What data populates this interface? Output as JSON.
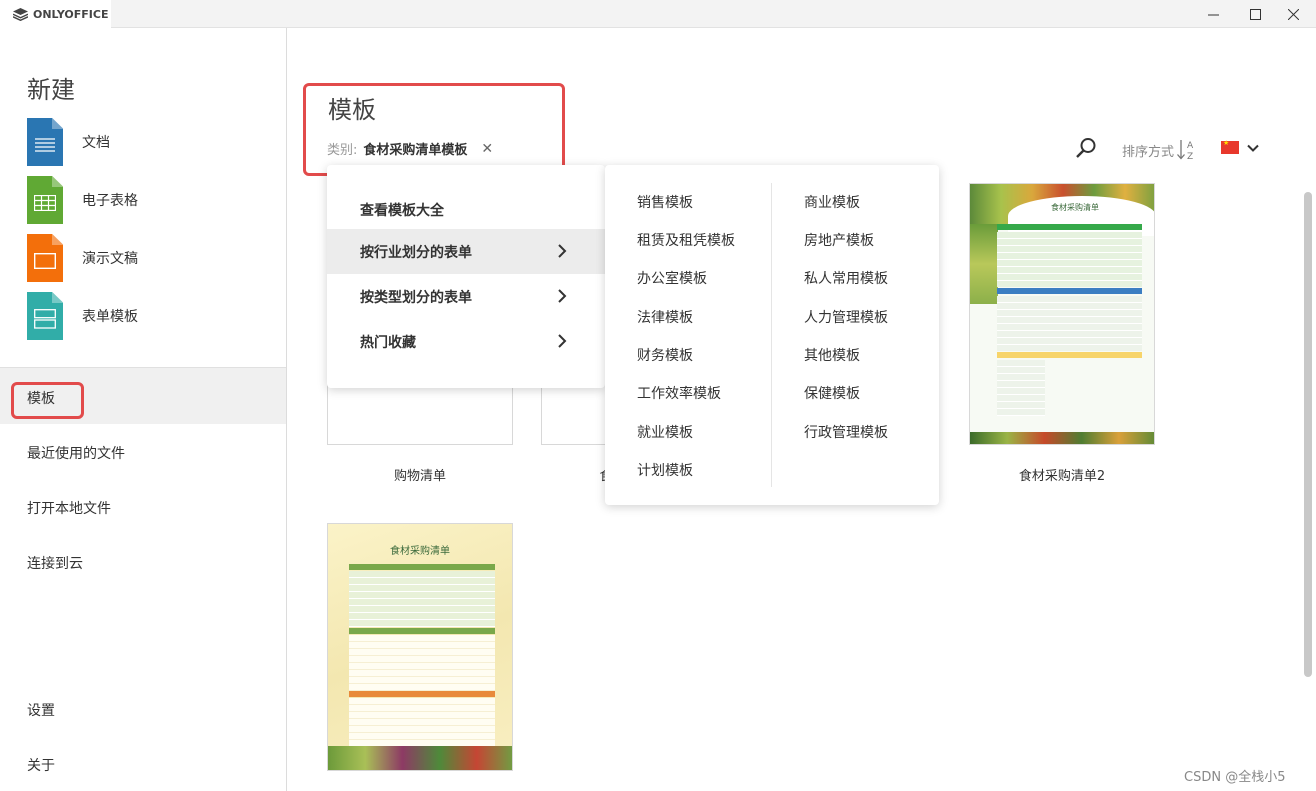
{
  "app": {
    "name": "ONLYOFFICE"
  },
  "sidebar": {
    "heading": "新建",
    "create": [
      {
        "label": "文档",
        "color": "#2a76b2"
      },
      {
        "label": "电子表格",
        "color": "#60a934"
      },
      {
        "label": "演示文稿",
        "color": "#f36f0b"
      },
      {
        "label": "表单模板",
        "color": "#31ada8"
      }
    ],
    "nav": [
      "模板",
      "最近使用的文件",
      "打开本地文件",
      "连接到云"
    ],
    "bottom": [
      "设置",
      "关于"
    ]
  },
  "main": {
    "title": "模板",
    "category_key": "类别:",
    "category_value": "食材采购清单模板",
    "category_clear": "✕",
    "sort_label": "排序方式",
    "cards": [
      "购物清单",
      "食",
      "食材采购清单2"
    ],
    "thumb_title": "食材采购清单"
  },
  "menu": {
    "level1": [
      "查看模板大全",
      "按行业划分的表单",
      "按类型划分的表单",
      "热门收藏"
    ],
    "level2_left": [
      "销售模板",
      "租赁及租凭模板",
      "办公室模板",
      "法律模板",
      "财务模板",
      "工作效率模板",
      "就业模板",
      "计划模板"
    ],
    "level2_right": [
      "商业模板",
      "房地产模板",
      "私人常用模板",
      "人力管理模板",
      "其他模板",
      "保健模板",
      "行政管理模板"
    ]
  },
  "watermark": "CSDN @全栈小5"
}
